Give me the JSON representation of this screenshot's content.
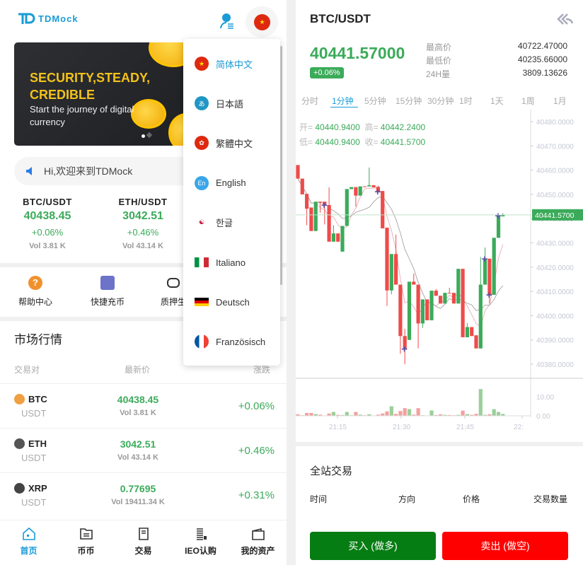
{
  "header": {
    "logo_text": "TDMock",
    "user_icon": "user-list-icon",
    "lang_flag": "cn-flag-icon"
  },
  "banner": {
    "title": "SECURITY,STEADY, CREDIBLE",
    "subtitle": "Start the journey of digital currency",
    "slide_count": 2,
    "active_slide": 1
  },
  "notice": {
    "text": "Hi,欢迎来到TDMock",
    "icon": "speaker-icon"
  },
  "tickers": [
    {
      "pair": "BTC/USDT",
      "price": "40438.45",
      "change": "+0.06%",
      "vol": "Vol 3.81 K"
    },
    {
      "pair": "ETH/USDT",
      "price": "3042.51",
      "change": "+0.46%",
      "vol": "Vol 43.14 K"
    }
  ],
  "quick": [
    {
      "label": "帮助中心",
      "icon": "help-icon"
    },
    {
      "label": "快捷充币",
      "icon": "deposit-icon"
    },
    {
      "label": "质押生",
      "icon": "robot-icon"
    }
  ],
  "market": {
    "title": "市场行情",
    "cols": [
      "交易对",
      "最新价",
      "涨跌"
    ],
    "rows": [
      {
        "sym": "BTC",
        "quote": "USDT",
        "price": "40438.45",
        "vol": "Vol 3.81 K",
        "change": "+0.06%",
        "color": "#f0a040"
      },
      {
        "sym": "ETH",
        "quote": "USDT",
        "price": "3042.51",
        "vol": "Vol 43.14 K",
        "change": "+0.46%",
        "color": "#555"
      },
      {
        "sym": "XRP",
        "quote": "USDT",
        "price": "0.77695",
        "vol": "Vol 19411.34 K",
        "change": "+0.31%",
        "color": "#444"
      }
    ]
  },
  "nav": [
    {
      "label": "首页",
      "active": true
    },
    {
      "label": "币币"
    },
    {
      "label": "交易"
    },
    {
      "label": "IEO认购"
    },
    {
      "label": "我的资产"
    }
  ],
  "languages": [
    {
      "label": "简体中文",
      "active": true,
      "flag": "cn"
    },
    {
      "label": "日本語",
      "flag": "jp"
    },
    {
      "label": "繁體中文",
      "flag": "hk"
    },
    {
      "label": "English",
      "flag": "en"
    },
    {
      "label": "한글",
      "flag": "kr"
    },
    {
      "label": "Italiano",
      "flag": "it"
    },
    {
      "label": "Deutsch",
      "flag": "de"
    },
    {
      "label": "Französisch",
      "flag": "fr"
    }
  ],
  "detail": {
    "pair": "BTC/USDT",
    "price": "40441.57000",
    "change": "+0.06%",
    "stats": [
      {
        "label": "最高价",
        "value": "40722.47000"
      },
      {
        "label": "最低价",
        "value": "40235.66000"
      },
      {
        "label": "24H量",
        "value": "3809.13626"
      }
    ],
    "tabs": [
      "分时",
      "1分钟",
      "5分钟",
      "15分钟",
      "30分钟",
      "1时",
      "1天",
      "1周",
      "1月"
    ],
    "active_tab": "1分钟",
    "ohlc": {
      "open_label": "开=",
      "open": "40440.9400",
      "high_label": "高=",
      "high": "40442.2400",
      "low_label": "低=",
      "low": "40440.9400",
      "close_label": "收=",
      "close": "40441.5700"
    },
    "trades_title": "全站交易",
    "trade_cols": [
      "时间",
      "方向",
      "价格",
      "交易数量"
    ],
    "buy_label": "买入 (做多)",
    "sell_label": "卖出 (做空)"
  },
  "colors": {
    "up": "#3bab5a",
    "down": "#ee4b4b",
    "accent": "#1a9bd7",
    "buy": "#067d13",
    "sell": "#ff0000"
  },
  "chart_data": {
    "type": "candlestick",
    "y_ticks": [
      "40480.0000",
      "40470.0000",
      "40460.0000",
      "40450.0000",
      "40440.0000",
      "40430.0000",
      "40420.0000",
      "40410.0000",
      "40400.0000",
      "40390.0000",
      "40380.0000"
    ],
    "ylim": [
      40376,
      40484
    ],
    "last_price_label": "40441.5700",
    "last_price": 40441.57,
    "x_ticks": [
      "21:15",
      "21:30",
      "21:45",
      "22:"
    ],
    "vol_ticks": [
      "10.00",
      "0.00"
    ],
    "candles": [
      [
        40462.1,
        40456.5,
        40462.1,
        40456.5
      ],
      [
        40456.5,
        40450,
        40456.5,
        40450
      ],
      [
        40450.2,
        40444.1,
        40450.2,
        40437.3
      ],
      [
        40444.6,
        40434.9,
        40444.6,
        40434.9
      ],
      [
        40434.9,
        40447,
        40447,
        40434.9
      ],
      [
        40447,
        40446.8,
        40447.1,
        40442.5
      ],
      [
        40447,
        40445.6,
        40447,
        40437.6
      ],
      [
        40445.6,
        40430.5,
        40452.9,
        40430.5
      ],
      [
        40430.5,
        40433.9,
        40437.3,
        40430.5
      ],
      [
        40433.9,
        40430.5,
        40433.9,
        40430.5
      ],
      [
        40426.4,
        40437,
        40437,
        40426.4
      ],
      [
        40437,
        40452.2,
        40452.2,
        40437
      ],
      [
        40452.2,
        40453,
        40453,
        40452.2
      ],
      [
        40453,
        40449.5,
        40453,
        40445
      ],
      [
        40449.5,
        40453.3,
        40453.3,
        40449.5
      ],
      [
        40453.3,
        40453.2,
        40453.4,
        40453.1
      ],
      [
        40453.3,
        40453.8,
        40461.1,
        40453.3
      ],
      [
        40453.8,
        40452.9,
        40453.8,
        40452.9
      ],
      [
        40453.1,
        40451.2,
        40453.6,
        40451.2
      ],
      [
        40451.4,
        40436,
        40451.4,
        40436
      ],
      [
        40436.3,
        40410.4,
        40436.3,
        40404
      ],
      [
        40410.4,
        40425.4,
        40425.4,
        40408.8
      ],
      [
        40425.4,
        40412.8,
        40433.4,
        40412.8
      ],
      [
        40412.8,
        40391.6,
        40412.8,
        40384.3
      ],
      [
        40391.6,
        40386.3,
        40394.5,
        40380
      ],
      [
        40390,
        40414,
        40414,
        40390
      ],
      [
        40414,
        40412.8,
        40417.4,
        40412.8
      ],
      [
        40412.8,
        40396.8,
        40412.8,
        40386.5
      ],
      [
        40396.8,
        40406.7,
        40406.7,
        40395
      ],
      [
        40406.7,
        40398.1,
        40406.7,
        40398.1
      ],
      [
        40398.1,
        40410.3,
        40410.3,
        40398.1
      ],
      [
        40410.3,
        40408.2,
        40411,
        40408.2
      ],
      [
        40408.2,
        40405,
        40408.2,
        40405
      ],
      [
        40405,
        40409.4,
        40409.4,
        40405
      ],
      [
        40409.4,
        40409.3,
        40411.5,
        40409.3
      ],
      [
        40409.4,
        40405,
        40409.4,
        40405
      ],
      [
        40405,
        40419.3,
        40419.3,
        40405
      ],
      [
        40419.3,
        40391.1,
        40419.3,
        40391.1
      ],
      [
        40391.1,
        40395.3,
        40397,
        40391.1
      ],
      [
        40395.3,
        40391.6,
        40395.3,
        40391.6
      ],
      [
        40391.9,
        40386.5,
        40391.9,
        40386.5
      ],
      [
        40386.5,
        40412.8,
        40424.2,
        40386.5
      ],
      [
        40412.8,
        40423.5,
        40428.1,
        40412.8
      ],
      [
        40423.5,
        40408.6,
        40423.5,
        40405
      ],
      [
        40408.6,
        40432.1,
        40432.1,
        40408.6
      ],
      [
        40432.1,
        40441.2,
        40441.2,
        40432.1
      ],
      [
        40440.94,
        40441.57,
        40442.24,
        40440.94
      ]
    ],
    "volumes": [
      0.8,
      0.3,
      1.5,
      1.5,
      0.9,
      0.6,
      0.2,
      1.2,
      2.0,
      0.5,
      0.4,
      2.0,
      0.3,
      2.0,
      0.6,
      0.3,
      0.8,
      0.2,
      0.6,
      1.2,
      2.3,
      5.0,
      1.0,
      2.5,
      4.0,
      3.5,
      0.6,
      4.0,
      0.3,
      0.2,
      2.8,
      0.4,
      0.8,
      0.5,
      0.4,
      0.3,
      0.5,
      2.7,
      0.9,
      0.5,
      1.0,
      14.0,
      0.5,
      0.8,
      3.5,
      2.0,
      1.0
    ],
    "marker_candle_indices": [
      6,
      18,
      24,
      42,
      43,
      45
    ]
  }
}
